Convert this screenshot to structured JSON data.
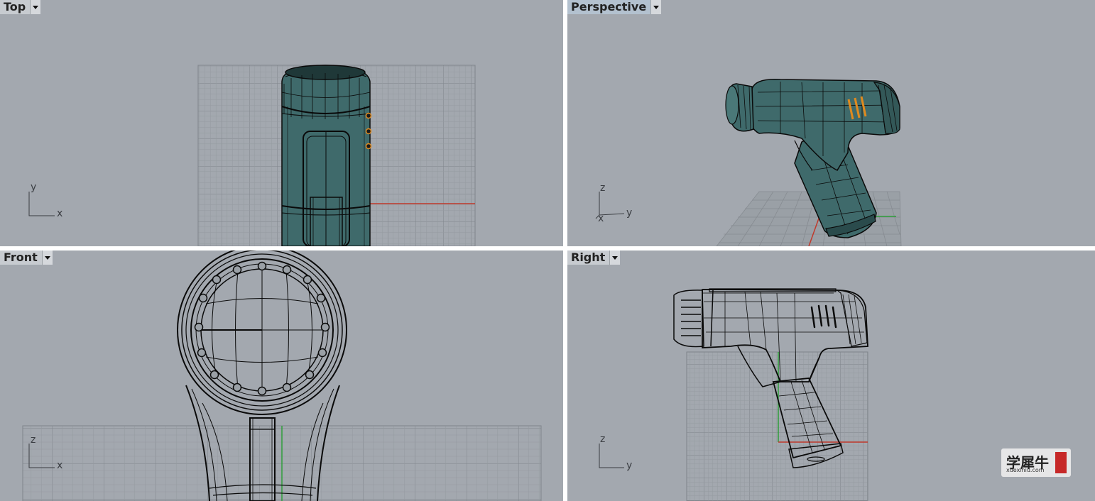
{
  "viewports": {
    "top": {
      "title": "Top",
      "axis_v": "y",
      "axis_h": "x"
    },
    "perspective": {
      "title": "Perspective",
      "axis_v": "z",
      "axis_h": "y",
      "axis_d": "x"
    },
    "front": {
      "title": "Front",
      "axis_v": "z",
      "axis_h": "x"
    },
    "right": {
      "title": "Right",
      "axis_v": "z",
      "axis_h": "y"
    }
  },
  "active_viewport": "perspective",
  "colors": {
    "viewport_bg": "#a3a8af",
    "model_fill": "#3f6a6b",
    "wire": "#0a0a0a",
    "grid": "#8e9399",
    "x_axis": "#c0392b",
    "y_axis": "#2e9e3a",
    "vent_accent": "#e08a1e"
  },
  "icons": [
    "dropdown-arrow-icon",
    "axis-triad-icon"
  ],
  "watermark": {
    "chinese": "学犀牛",
    "latin": "xuexiniu.com"
  }
}
